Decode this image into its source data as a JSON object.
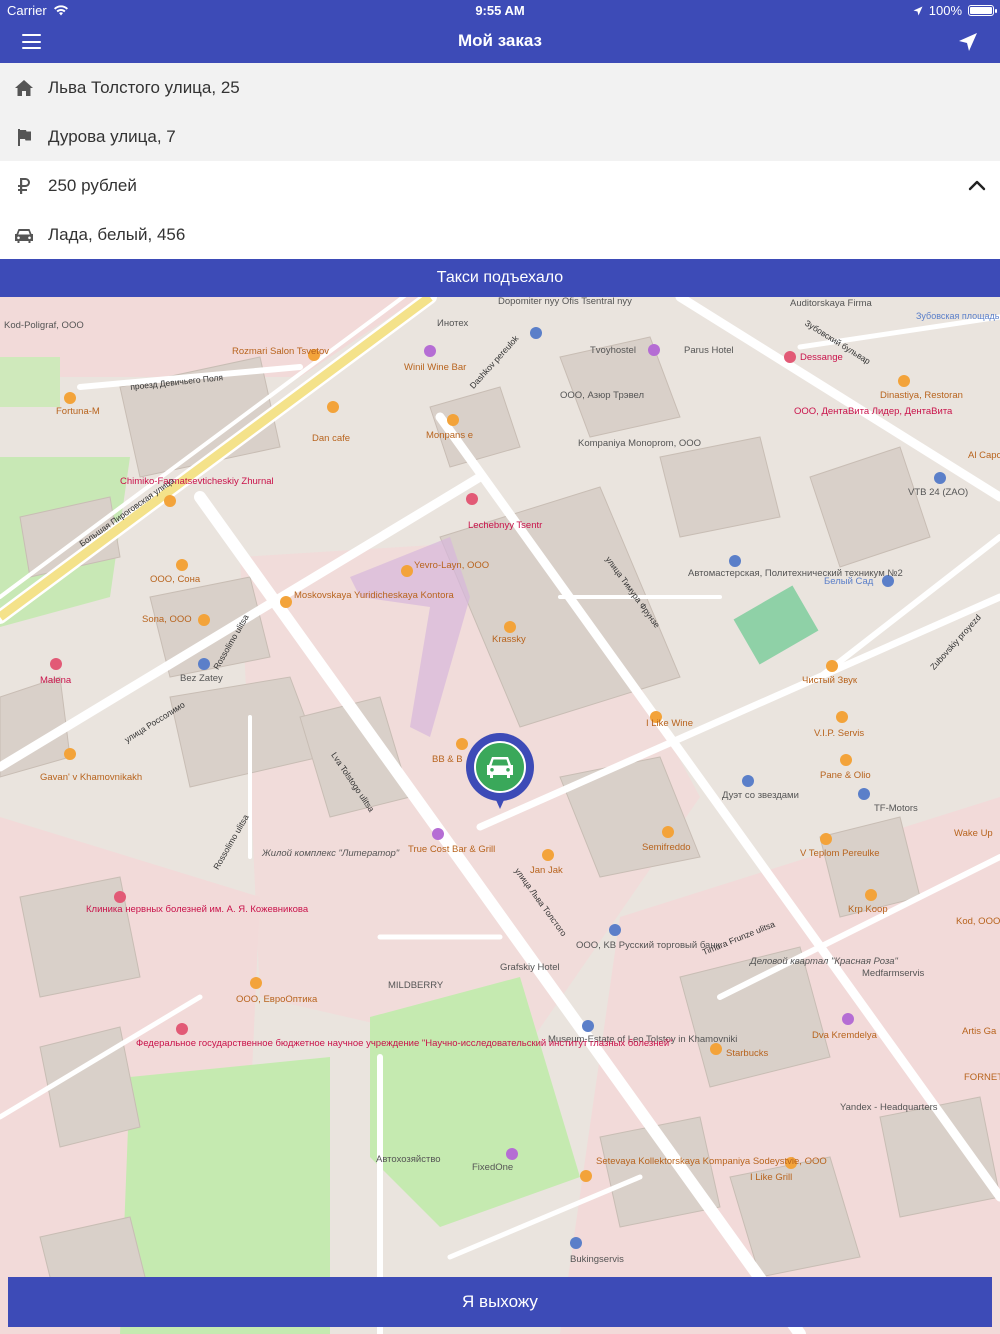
{
  "status_bar": {
    "carrier": "Carrier",
    "time": "9:55 AM",
    "battery": "100%"
  },
  "nav": {
    "title": "Мой заказ",
    "left_icon": "menu-icon",
    "right_icon": "location-arrow-icon"
  },
  "order": {
    "from": {
      "icon": "home-icon",
      "text": "Льва Толстого улица, 25"
    },
    "to": {
      "icon": "flag-icon",
      "text": "Дурова улица, 7"
    },
    "price": {
      "icon": "ruble-icon",
      "text": "250 рублей"
    },
    "car": {
      "icon": "car-icon",
      "text": "Лада, белый, 456"
    }
  },
  "status_message": "Такси подъехало",
  "map": {
    "labels": {
      "kod_poligraf": "Kod-Poligraf, OOO",
      "rozmari": "Rozmari Salon Tsvetov",
      "fortuna": "Fortuna-M",
      "dan_cafe": "Dan cafe",
      "winil": "Winil Wine Bar",
      "monpans": "Monpans e",
      "dopomiter": "Dopomiter nyy Ofis Tsentral nyy",
      "inotex": "Инотех",
      "tvoyhostel": "Tvoyhostel",
      "parus": "Parus Hotel",
      "dessange": "Dessange",
      "auditorskaya": "Auditorskaya Firma",
      "zubovskaya": "Зубовская площадь",
      "ooo_azur": "ООО, Азюр Трэвел",
      "kompaniya": "Kompaniya Monoprom, OOO",
      "dinastiya": "Dinastiya, Restoran",
      "dentavita": "ООО, ДентаВита Лидер, ДентаВита",
      "vtb": "VTB 24 (ZAO)",
      "al_capone": "Al Capo",
      "chimiko": "Chimiko-Farmatsevticheskiy Zhurnal",
      "lechebny": "Lechebnyy Tsentr",
      "yevro": "Yevro-Layn, OOO",
      "moskovskaya": "Moskovskaya Yuridicheskaya Kontora",
      "ooo_sona": "OOO, Сона",
      "sona_ooo": "Sona, OOO",
      "krassky": "Krassky",
      "avtomasterskaya": "Автомастерская, Политехнический техникум №2",
      "belyy_sad": "Белый Сад",
      "malena": "Malena",
      "bez_zatey": "Bez Zatey",
      "chistyy_zvuk": "Чистый Звук",
      "i_like_wine": "I Like Wine",
      "vip_servis": "V.I.P. Servis",
      "pane_olio": "Pane & Olio",
      "gavan": "Gavan' v Khamovnikakh",
      "duet": "Дуэт со звездами",
      "tf_motors": "TF-Motors",
      "wake_up": "Wake Up",
      "bb": "BB & B",
      "true_cost": "True Cost Bar & Grill",
      "semifreddo": "Semifreddo",
      "v_teplom": "V Teplom Pereulke",
      "jan_jak": "Jan Jak",
      "zhiloy": "Жилой комплекс \"Литератор\"",
      "krp_koop": "Krp Koop",
      "kod_ooo": "Kod, OOO",
      "klinika": "Клиника нервных болезней им. А. Я. Кожевникова",
      "ooo_kb": "OOO, KB Русский торговый банк",
      "grafskiy": "Grafskiy Hotel",
      "mildberry": "MILDBERRY",
      "delovoy": "Деловой квартал \"Красная Роза\"",
      "medfarmservis": "Medfarmservis",
      "evrooptika": "OOO, ЕвроОптика",
      "museum": "Museum-Estate of Leo Tolstoy in Khamovniki",
      "dva_kremdelya": "Dva Kremdelya",
      "starbucks": "Starbucks",
      "fed": "Федеральное государственное бюджетное научное учреждение \"Научно-исследовательский институт глазных болезней\"",
      "yandex": "Yandex - Headquarters",
      "setevaya": "Setevaya Kollektorskaya Kompaniya Sodeystvie, OOO",
      "fixed_one": "FixedOne",
      "i_like_grill": "I Like Grill",
      "bukingservis": "Bukingservis",
      "forne": "FORNET",
      "artis": "Artis Ga",
      "avtohozyaystvo": "Автохозяйство",
      "rossolimo_1": "Rossolimo ulitsa",
      "rossolimo_2": "Rossolimo ulitsa",
      "street_tolstogo": "улица Льва Толстого",
      "street_tolstogo2": "Lva Tolstogo ulitsa",
      "street_timura": "улица Тимура Фрунзе",
      "street_timura2": "Timura Frunze ulitsa",
      "street_zubovsky": "Зубовский бульвар",
      "street_pirogovskaya": "Большая Пироговская улица",
      "street_devichie": "проезд Девичьего Поля",
      "street_rossolimo": "улица Россолимо",
      "street_zubovsky_proezd": "Zubovskiy proyezd",
      "street_dashkov": "Dashkov pereulok"
    }
  },
  "exit_button": "Я выхожу"
}
